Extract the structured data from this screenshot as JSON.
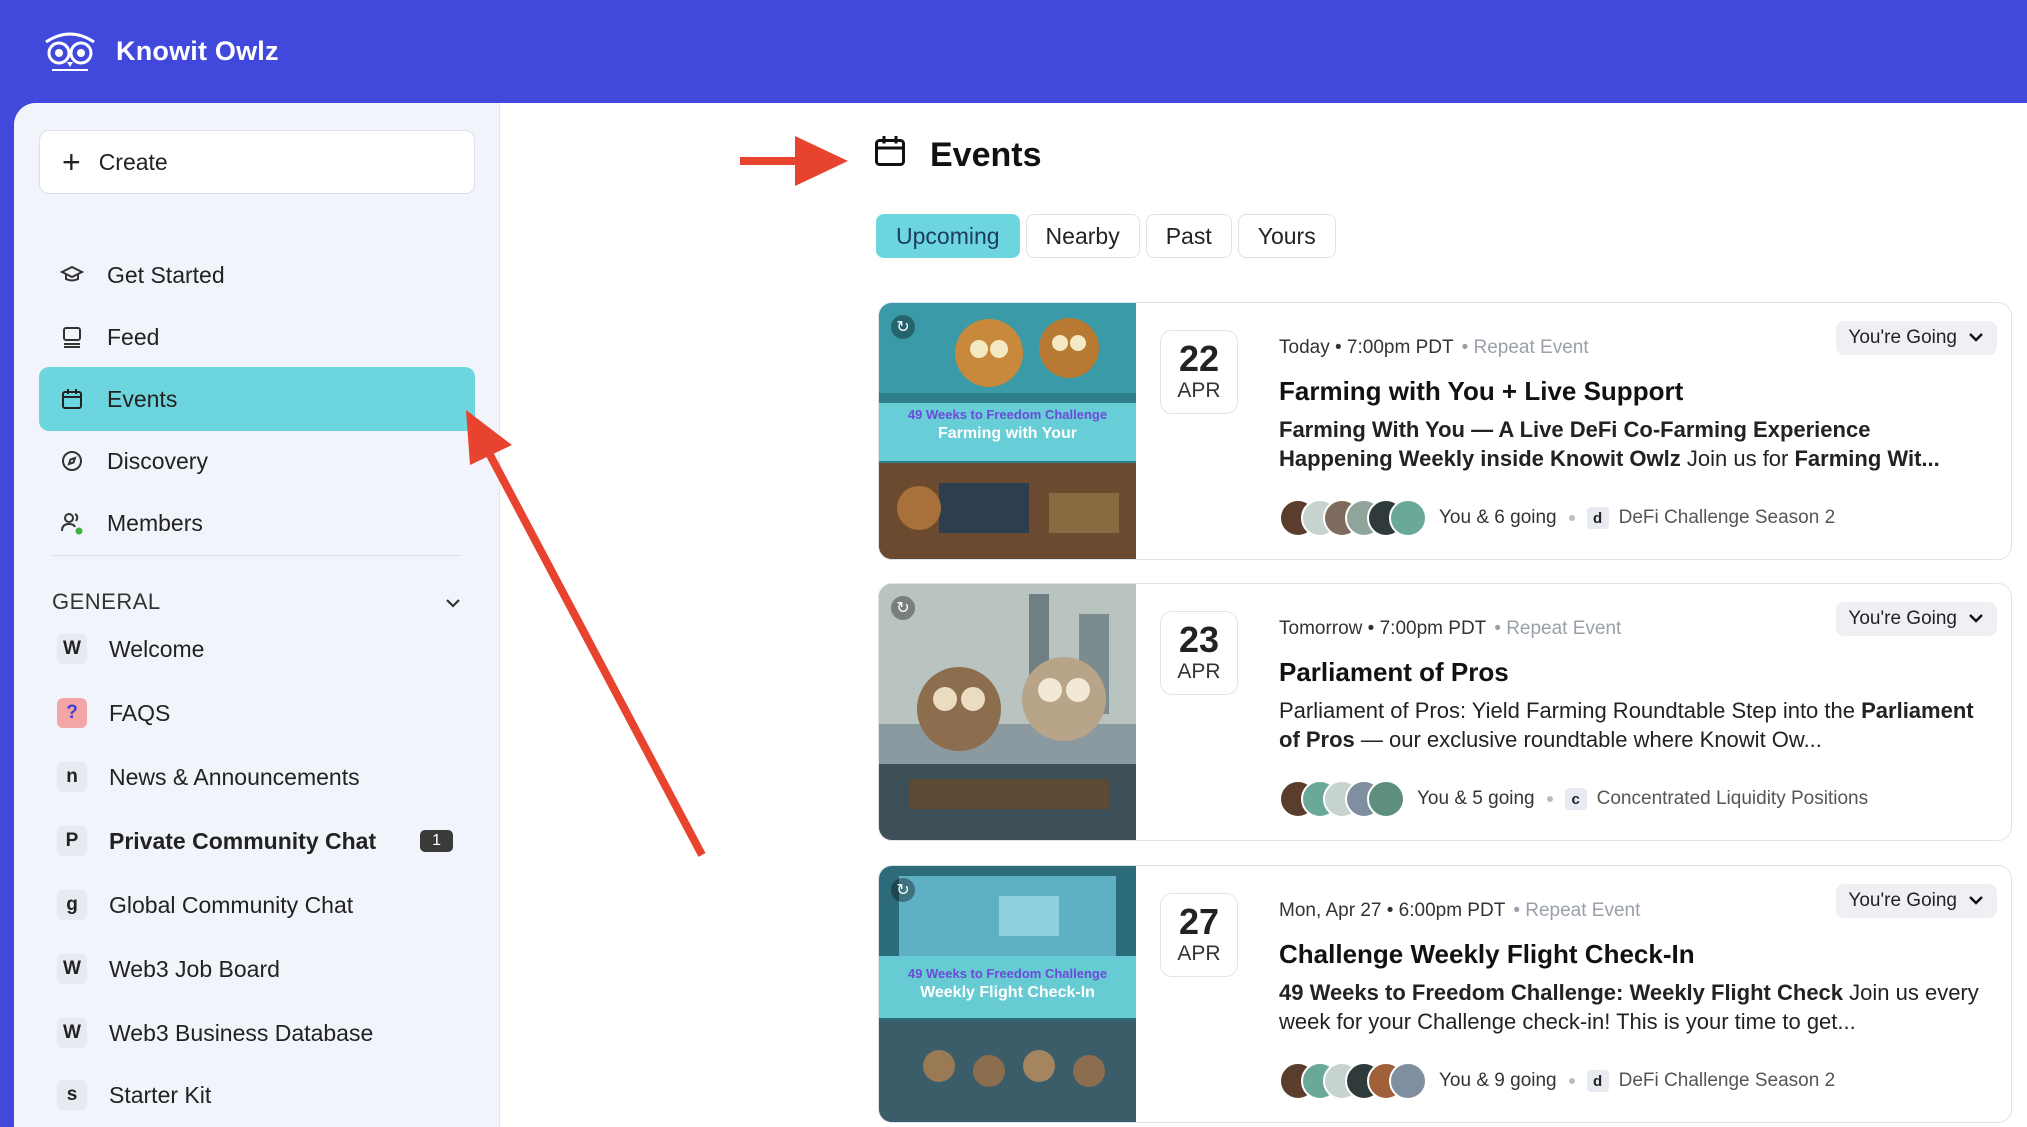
{
  "app": {
    "name": "Knowit Owlz"
  },
  "sidebar": {
    "create_label": "Create",
    "nav": [
      {
        "label": "Get Started",
        "icon": "graduation-cap-icon"
      },
      {
        "label": "Feed",
        "icon": "feed-icon"
      },
      {
        "label": "Events",
        "icon": "calendar-icon",
        "active": true
      },
      {
        "label": "Discovery",
        "icon": "compass-icon"
      },
      {
        "label": "Members",
        "icon": "members-icon"
      }
    ],
    "section_title": "GENERAL",
    "channels": [
      {
        "letter": "W",
        "label": "Welcome"
      },
      {
        "letter": "?",
        "label": "FAQS"
      },
      {
        "letter": "n",
        "label": "News & Announcements"
      },
      {
        "letter": "P",
        "label": "Private Community Chat",
        "count": "1"
      },
      {
        "letter": "g",
        "label": "Global Community Chat"
      },
      {
        "letter": "W",
        "label": "Web3 Job Board"
      },
      {
        "letter": "W",
        "label": "Web3 Business Database"
      },
      {
        "letter": "s",
        "label": "Starter Kit"
      }
    ]
  },
  "main": {
    "title": "Events",
    "tabs": [
      "Upcoming",
      "Nearby",
      "Past",
      "Yours"
    ],
    "events": [
      {
        "day": "22",
        "month": "APR",
        "when": "Today • 7:00pm PDT",
        "repeat": "• Repeat Event",
        "rsvp": "You're Going",
        "title": "Farming with You + Live Support",
        "desc_bold": "Farming With You — A Live DeFi Co-Farming Experience Happening Weekly inside Knowit Owlz",
        "desc_rest": " Join us for ",
        "desc_bold2": "Farming Wit...",
        "going": "You & 6 going",
        "channel_letter": "d",
        "channel": "DeFi Challenge Season 2",
        "image_caption_1": "49 Weeks to Freedom Challenge",
        "image_caption_2": "Farming with Your"
      },
      {
        "day": "23",
        "month": "APR",
        "when": "Tomorrow • 7:00pm PDT",
        "repeat": "• Repeat Event",
        "rsvp": "You're Going",
        "title": "Parliament of Pros",
        "desc_rest": " Parliament of Pros: Yield Farming Roundtable Step into the ",
        "desc_bold": "Parliament of Pros",
        "desc_rest2": " — our exclusive roundtable where Knowit Ow...",
        "going": "You & 5 going",
        "channel_letter": "c",
        "channel": "Concentrated Liquidity Positions"
      },
      {
        "day": "27",
        "month": "APR",
        "when": "Mon, Apr 27 • 6:00pm PDT",
        "repeat": "• Repeat Event",
        "rsvp": "You're Going",
        "title": "Challenge Weekly Flight Check-In",
        "desc_bold": "49 Weeks to Freedom Challenge: Weekly Flight Check",
        "desc_rest": " Join us every week for your Challenge check-in! This is your time to get...",
        "going": "You & 9 going",
        "channel_letter": "d",
        "channel": "DeFi Challenge Season 2",
        "image_caption_1": "49 Weeks to Freedom Challenge",
        "image_caption_2": "Weekly Flight Check-In"
      }
    ]
  },
  "colors": {
    "brand": "#4049dc",
    "accent": "#6dd5dd",
    "annotation_arrow": "#e8432f"
  }
}
